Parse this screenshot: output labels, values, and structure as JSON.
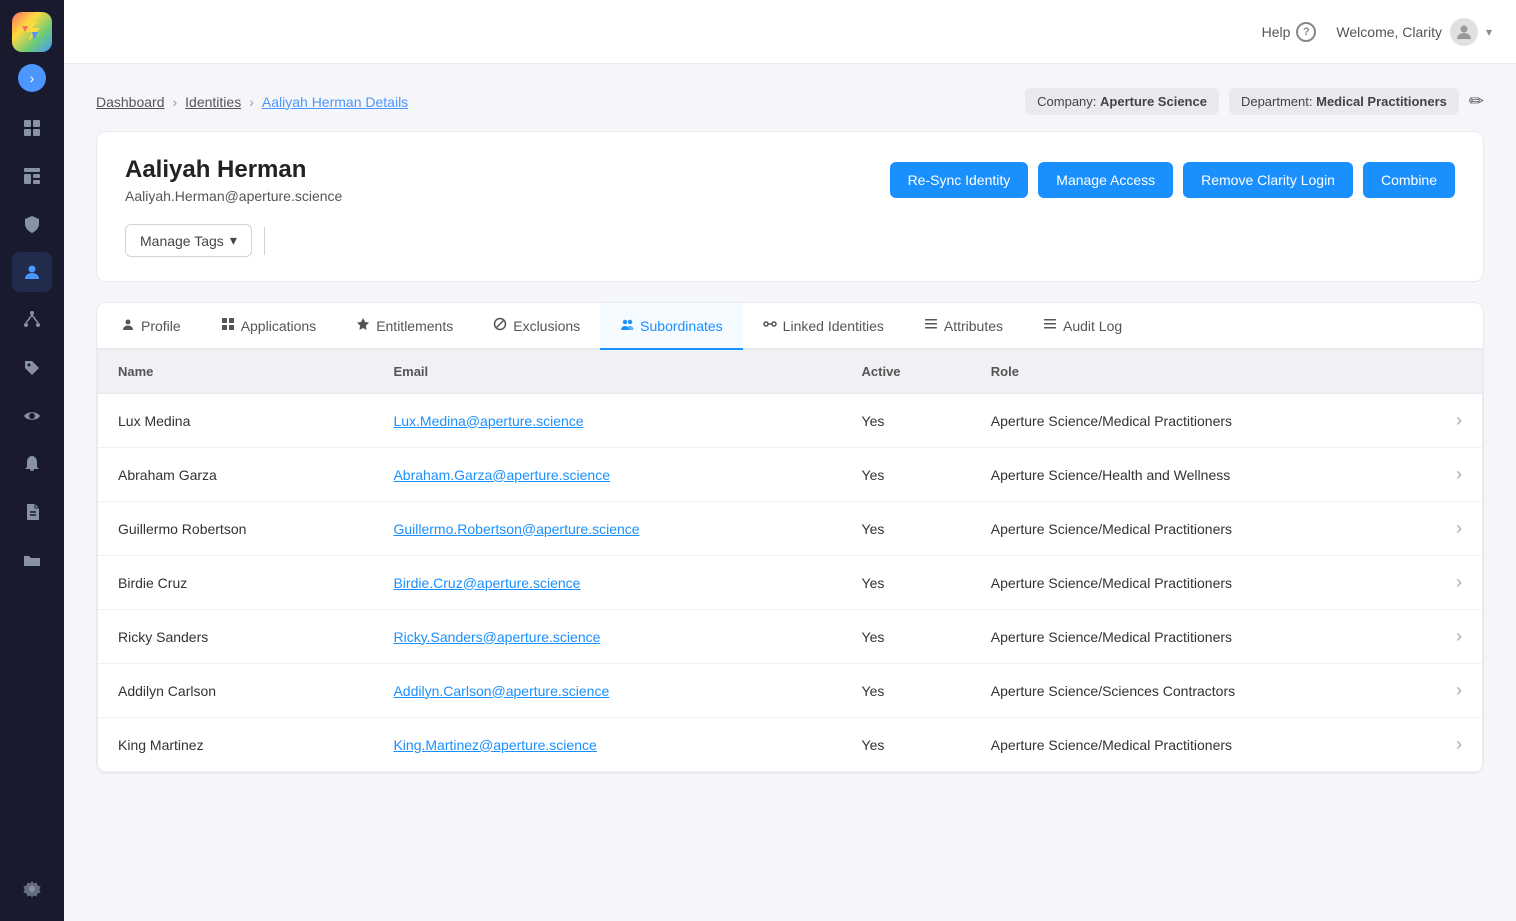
{
  "header": {
    "help_label": "Help",
    "welcome_label": "Welcome, Clarity",
    "user_icon": "👤"
  },
  "sidebar": {
    "logo_text": "V",
    "icons": [
      {
        "name": "dashboard-icon",
        "glyph": "▦",
        "active": false
      },
      {
        "name": "widget-icon",
        "glyph": "⊞",
        "active": false
      },
      {
        "name": "shield-icon",
        "glyph": "⛨",
        "active": false
      },
      {
        "name": "people-icon",
        "glyph": "👤",
        "active": true
      },
      {
        "name": "hierarchy-icon",
        "glyph": "⑂",
        "active": false
      },
      {
        "name": "tag-icon",
        "glyph": "🏷",
        "active": false
      },
      {
        "name": "eye-icon",
        "glyph": "👁",
        "active": false
      },
      {
        "name": "bell-icon",
        "glyph": "🔔",
        "active": false
      },
      {
        "name": "doc-icon",
        "glyph": "📄",
        "active": false
      },
      {
        "name": "folder-icon",
        "glyph": "📁",
        "active": false
      },
      {
        "name": "gear-icon",
        "glyph": "⚙",
        "active": false
      }
    ]
  },
  "breadcrumb": {
    "dashboard": "Dashboard",
    "identities": "Identities",
    "current": "Aaliyah Herman Details"
  },
  "badges": {
    "company_label": "Company:",
    "company_value": "Aperture Science",
    "department_label": "Department:",
    "department_value": "Medical Practitioners"
  },
  "identity": {
    "name": "Aaliyah Herman",
    "email": "Aaliyah.Herman@aperture.science"
  },
  "actions": {
    "resync": "Re-Sync Identity",
    "manage_access": "Manage Access",
    "remove_clarity": "Remove Clarity Login",
    "combine": "Combine"
  },
  "manage_tags": {
    "label": "Manage Tags"
  },
  "tabs": [
    {
      "id": "profile",
      "label": "Profile",
      "icon": "👤",
      "active": false
    },
    {
      "id": "applications",
      "label": "Applications",
      "icon": "⊞",
      "active": false
    },
    {
      "id": "entitlements",
      "label": "Entitlements",
      "icon": "◈",
      "active": false
    },
    {
      "id": "exclusions",
      "label": "Exclusions",
      "icon": "⊘",
      "active": false
    },
    {
      "id": "subordinates",
      "label": "Subordinates",
      "icon": "👥",
      "active": true
    },
    {
      "id": "linked-identities",
      "label": "Linked Identities",
      "icon": "⇌",
      "active": false
    },
    {
      "id": "attributes",
      "label": "Attributes",
      "icon": "≡",
      "active": false
    },
    {
      "id": "audit-log",
      "label": "Audit Log",
      "icon": "≡",
      "active": false
    }
  ],
  "table": {
    "columns": [
      "Name",
      "Email",
      "Active",
      "Role"
    ],
    "rows": [
      {
        "name": "Lux Medina",
        "email": "Lux.Medina@aperture.science",
        "active": "Yes",
        "role": "Aperture Science/Medical Practitioners"
      },
      {
        "name": "Abraham Garza",
        "email": "Abraham.Garza@aperture.science",
        "active": "Yes",
        "role": "Aperture Science/Health and Wellness"
      },
      {
        "name": "Guillermo Robertson",
        "email": "Guillermo.Robertson@aperture.science",
        "active": "Yes",
        "role": "Aperture Science/Medical Practitioners"
      },
      {
        "name": "Birdie Cruz",
        "email": "Birdie.Cruz@aperture.science",
        "active": "Yes",
        "role": "Aperture Science/Medical Practitioners"
      },
      {
        "name": "Ricky Sanders",
        "email": "Ricky.Sanders@aperture.science",
        "active": "Yes",
        "role": "Aperture Science/Medical Practitioners"
      },
      {
        "name": "Addilyn Carlson",
        "email": "Addilyn.Carlson@aperture.science",
        "active": "Yes",
        "role": "Aperture Science/Sciences Contractors"
      },
      {
        "name": "King Martinez",
        "email": "King.Martinez@aperture.science",
        "active": "Yes",
        "role": "Aperture Science/Medical Practitioners"
      }
    ]
  }
}
